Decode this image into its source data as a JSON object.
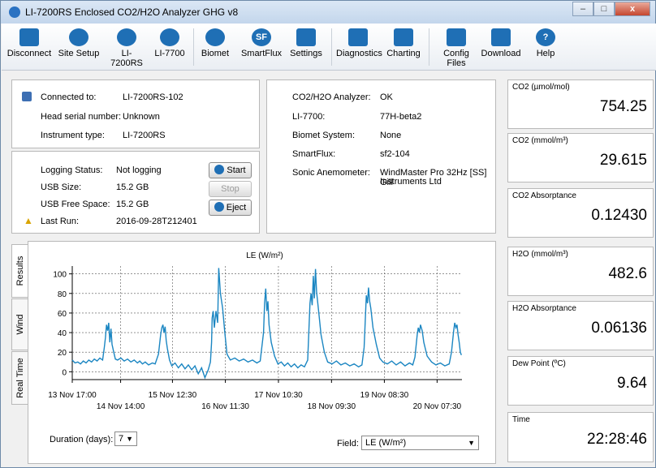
{
  "window": {
    "title": "LI-7200RS Enclosed CO2/H2O Analyzer GHG v8",
    "min": "–",
    "max": "□",
    "close": "x"
  },
  "toolbar": {
    "disconnect": "Disconnect",
    "site_setup": "Site Setup",
    "li7200rs": "LI-7200RS",
    "li7700": "LI-7700",
    "biomet": "Biomet",
    "smartflux": "SmartFlux",
    "settings": "Settings",
    "diagnostics": "Diagnostics",
    "charting": "Charting",
    "config_files": "Config Files",
    "download": "Download",
    "help": "Help",
    "sf_glyph": "SF",
    "help_glyph": "?"
  },
  "connection": {
    "connected_label": "Connected to:",
    "connected_value": "LI-7200RS-102",
    "serial_label": "Head serial number:",
    "serial_value": "Unknown",
    "type_label": "Instrument type:",
    "type_value": "LI-7200RS"
  },
  "logging": {
    "status_label": "Logging Status:",
    "status_value": "Not logging",
    "usb_size_label": "USB Size:",
    "usb_size_value": "15.2 GB",
    "usb_free_label": "USB Free Space:",
    "usb_free_value": "15.2 GB",
    "last_run_label": "Last Run:",
    "last_run_value": "2016-09-28T212401",
    "start": "Start",
    "stop": "Stop",
    "eject": "Eject"
  },
  "status": {
    "analyzer_label": "CO2/H2O Analyzer:",
    "analyzer_value": "OK",
    "li7700_label": "LI-7700:",
    "li7700_value": "77H-beta2",
    "biomet_label": "Biomet System:",
    "biomet_value": "None",
    "smartflux_label": "SmartFlux:",
    "smartflux_value": "sf2-104",
    "sonic_label": "Sonic Anemometer:",
    "sonic_value_1": "WindMaster Pro 32Hz [SS] Gill",
    "sonic_value_2": "Instruments Ltd"
  },
  "meters": [
    {
      "label": "CO2 (µmol/mol)",
      "value": "754.25"
    },
    {
      "label": "CO2 (mmol/m³)",
      "value": "29.615"
    },
    {
      "label": "CO2 Absorptance",
      "value": "0.12430"
    },
    {
      "label": "H2O (mmol/m³)",
      "value": "482.6"
    },
    {
      "label": "H2O Absorptance",
      "value": "0.06136"
    },
    {
      "label": "Dew Point (ºC)",
      "value": "9.64"
    },
    {
      "label": "Time",
      "value": "22:28:46"
    }
  ],
  "tabs": {
    "results": "Results",
    "wind": "Wind",
    "realtime": "Real Time"
  },
  "controls": {
    "duration_label": "Duration (days):",
    "duration_value": "7",
    "field_label": "Field:",
    "field_value": "LE (W/m²)"
  },
  "colors": {
    "line": "#1b86c2",
    "accent": "#1f6fb5"
  },
  "chart_data": {
    "type": "line",
    "title": "LE (W/m²)",
    "ylim": [
      -8,
      108
    ],
    "yticks": [
      0,
      20,
      40,
      60,
      80,
      100
    ],
    "x_day_labels": [
      {
        "label": "13 Nov 17:00",
        "t": 0,
        "row": 0
      },
      {
        "label": "14 Nov 14:00",
        "t": 0.875,
        "row": 1
      },
      {
        "label": "15 Nov 12:30",
        "t": 1.8125,
        "row": 0
      },
      {
        "label": "16 Nov 11:30",
        "t": 2.77,
        "row": 1
      },
      {
        "label": "17 Nov 10:30",
        "t": 3.73,
        "row": 0
      },
      {
        "label": "18 Nov 09:30",
        "t": 4.69,
        "row": 1
      },
      {
        "label": "19 Nov 08:30",
        "t": 5.646,
        "row": 0
      },
      {
        "label": "20 Nov 07:30",
        "t": 6.6,
        "row": 1
      }
    ],
    "xlim": [
      0,
      7.05
    ],
    "grid": "dashed",
    "series": [
      {
        "values": [
          [
            0.0,
            12
          ],
          [
            0.05,
            9
          ],
          [
            0.1,
            10
          ],
          [
            0.15,
            8
          ],
          [
            0.2,
            11
          ],
          [
            0.25,
            9
          ],
          [
            0.3,
            12
          ],
          [
            0.35,
            10
          ],
          [
            0.4,
            13
          ],
          [
            0.45,
            11
          ],
          [
            0.5,
            14
          ],
          [
            0.55,
            12
          ],
          [
            0.58,
            25
          ],
          [
            0.6,
            35
          ],
          [
            0.62,
            48
          ],
          [
            0.64,
            42
          ],
          [
            0.66,
            50
          ],
          [
            0.68,
            30
          ],
          [
            0.7,
            44
          ],
          [
            0.72,
            28
          ],
          [
            0.75,
            20
          ],
          [
            0.78,
            13
          ],
          [
            0.82,
            12
          ],
          [
            0.88,
            14
          ],
          [
            0.94,
            11
          ],
          [
            1.0,
            13
          ],
          [
            1.06,
            10
          ],
          [
            1.12,
            12
          ],
          [
            1.18,
            9
          ],
          [
            1.22,
            11
          ],
          [
            1.27,
            8
          ],
          [
            1.32,
            10
          ],
          [
            1.38,
            7
          ],
          [
            1.45,
            9
          ],
          [
            1.5,
            8
          ],
          [
            1.56,
            18
          ],
          [
            1.6,
            38
          ],
          [
            1.62,
            45
          ],
          [
            1.64,
            48
          ],
          [
            1.66,
            40
          ],
          [
            1.68,
            46
          ],
          [
            1.7,
            32
          ],
          [
            1.72,
            24
          ],
          [
            1.76,
            12
          ],
          [
            1.8,
            6
          ],
          [
            1.86,
            9
          ],
          [
            1.92,
            4
          ],
          [
            1.98,
            8
          ],
          [
            2.04,
            3
          ],
          [
            2.1,
            7
          ],
          [
            2.16,
            2
          ],
          [
            2.22,
            6
          ],
          [
            2.28,
            -2
          ],
          [
            2.34,
            4
          ],
          [
            2.4,
            -6
          ],
          [
            2.46,
            2
          ],
          [
            2.5,
            10
          ],
          [
            2.52,
            30
          ],
          [
            2.53,
            55
          ],
          [
            2.55,
            62
          ],
          [
            2.57,
            45
          ],
          [
            2.6,
            62
          ],
          [
            2.63,
            50
          ],
          [
            2.65,
            106
          ],
          [
            2.68,
            80
          ],
          [
            2.72,
            65
          ],
          [
            2.76,
            40
          ],
          [
            2.8,
            18
          ],
          [
            2.86,
            12
          ],
          [
            2.94,
            14
          ],
          [
            3.02,
            11
          ],
          [
            3.1,
            13
          ],
          [
            3.18,
            10
          ],
          [
            3.26,
            12
          ],
          [
            3.34,
            9
          ],
          [
            3.4,
            11
          ],
          [
            3.46,
            40
          ],
          [
            3.48,
            70
          ],
          [
            3.5,
            85
          ],
          [
            3.52,
            62
          ],
          [
            3.54,
            72
          ],
          [
            3.56,
            48
          ],
          [
            3.6,
            30
          ],
          [
            3.66,
            16
          ],
          [
            3.72,
            8
          ],
          [
            3.78,
            10
          ],
          [
            3.84,
            6
          ],
          [
            3.9,
            9
          ],
          [
            3.96,
            5
          ],
          [
            4.02,
            8
          ],
          [
            4.08,
            4
          ],
          [
            4.14,
            7
          ],
          [
            4.2,
            5
          ],
          [
            4.26,
            12
          ],
          [
            4.3,
            70
          ],
          [
            4.32,
            80
          ],
          [
            4.34,
            68
          ],
          [
            4.36,
            98
          ],
          [
            4.38,
            75
          ],
          [
            4.4,
            105
          ],
          [
            4.42,
            82
          ],
          [
            4.46,
            60
          ],
          [
            4.5,
            38
          ],
          [
            4.56,
            20
          ],
          [
            4.62,
            10
          ],
          [
            4.7,
            8
          ],
          [
            4.78,
            11
          ],
          [
            4.86,
            7
          ],
          [
            4.94,
            9
          ],
          [
            5.02,
            6
          ],
          [
            5.1,
            8
          ],
          [
            5.18,
            5
          ],
          [
            5.24,
            7
          ],
          [
            5.28,
            25
          ],
          [
            5.32,
            78
          ],
          [
            5.34,
            70
          ],
          [
            5.36,
            86
          ],
          [
            5.38,
            72
          ],
          [
            5.4,
            65
          ],
          [
            5.44,
            45
          ],
          [
            5.5,
            28
          ],
          [
            5.56,
            14
          ],
          [
            5.62,
            10
          ],
          [
            5.7,
            8
          ],
          [
            5.78,
            11
          ],
          [
            5.86,
            7
          ],
          [
            5.94,
            10
          ],
          [
            6.02,
            6
          ],
          [
            6.1,
            9
          ],
          [
            6.16,
            7
          ],
          [
            6.2,
            15
          ],
          [
            6.24,
            38
          ],
          [
            6.26,
            45
          ],
          [
            6.28,
            40
          ],
          [
            6.3,
            48
          ],
          [
            6.33,
            42
          ],
          [
            6.36,
            30
          ],
          [
            6.42,
            16
          ],
          [
            6.5,
            10
          ],
          [
            6.58,
            7
          ],
          [
            6.66,
            9
          ],
          [
            6.74,
            6
          ],
          [
            6.82,
            8
          ],
          [
            6.86,
            20
          ],
          [
            6.9,
            42
          ],
          [
            6.92,
            50
          ],
          [
            6.94,
            45
          ],
          [
            6.96,
            48
          ],
          [
            6.98,
            38
          ],
          [
            7.0,
            30
          ],
          [
            7.02,
            20
          ],
          [
            7.04,
            17
          ]
        ]
      }
    ]
  }
}
